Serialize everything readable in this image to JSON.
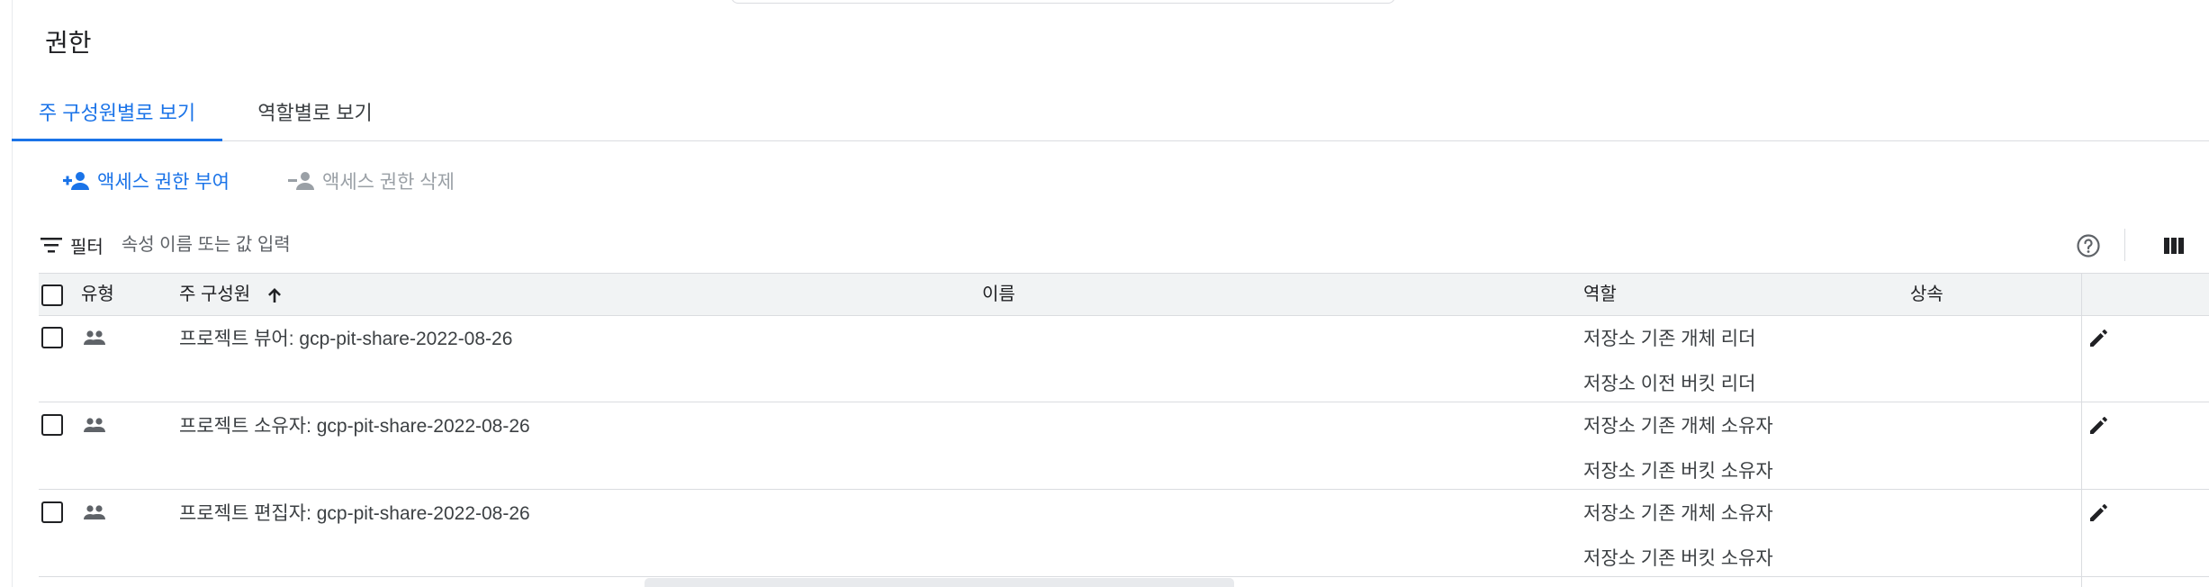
{
  "page": {
    "title": "권한"
  },
  "tabs": [
    {
      "label": "주 구성원별로 보기",
      "active": true
    },
    {
      "label": "역할별로 보기",
      "active": false
    }
  ],
  "actions": {
    "grant_label": "액세스 권한 부여",
    "remove_label": "액세스 권한 삭제"
  },
  "filter": {
    "label": "필터",
    "placeholder": "속성 이름 또는 값 입력",
    "icon": "filter-list-icon"
  },
  "toolbar_icons": {
    "help": "help-icon",
    "columns": "column-display-icon"
  },
  "table": {
    "columns": {
      "type": "유형",
      "principal": "주 구성원",
      "name": "이름",
      "role": "역할",
      "inheritance": "상속"
    },
    "sort": {
      "column": "principal",
      "direction": "ascending",
      "icon": "arrow-up-icon"
    },
    "rows": [
      {
        "type_icon": "group-icon",
        "principal": "프로젝트 뷰어: gcp-pit-share-2022-08-26",
        "roles": [
          "저장소 기존 개체 리더",
          "저장소 이전 버킷 리더"
        ]
      },
      {
        "type_icon": "group-icon",
        "principal": "프로젝트 소유자: gcp-pit-share-2022-08-26",
        "roles": [
          "저장소 기존 개체 소유자",
          "저장소 기존 버킷 소유자"
        ]
      },
      {
        "type_icon": "group-icon",
        "principal": "프로젝트 편집자: gcp-pit-share-2022-08-26",
        "roles": [
          "저장소 기존 개체 소유자",
          "저장소 기존 버킷 소유자"
        ]
      }
    ]
  },
  "colors": {
    "accent": "#1a73e8",
    "disabled": "#9aa0a6",
    "header_bg": "#f1f3f4",
    "border": "#dadce0"
  }
}
